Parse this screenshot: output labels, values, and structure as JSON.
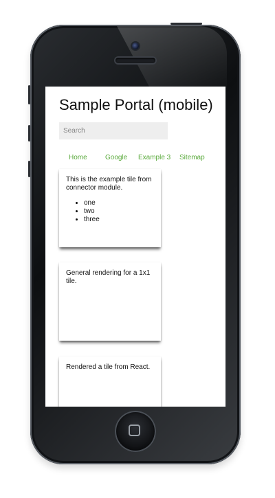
{
  "portal": {
    "title": "Sample Portal (mobile)"
  },
  "search": {
    "placeholder": "Search"
  },
  "nav": {
    "items": [
      {
        "label": "Home"
      },
      {
        "label": "Google"
      },
      {
        "label": "Example 3"
      },
      {
        "label": "Sitemap"
      }
    ]
  },
  "tiles": [
    {
      "text": "This is the example tile from connector module.",
      "list": [
        "one",
        "two",
        "three"
      ]
    },
    {
      "text": "General rendering for a 1x1 tile."
    },
    {
      "text": "Rendered a tile from React."
    }
  ],
  "colors": {
    "link": "#5aaa3c",
    "search_bg": "#eeeeee",
    "phone_body": "#1b1d20"
  }
}
